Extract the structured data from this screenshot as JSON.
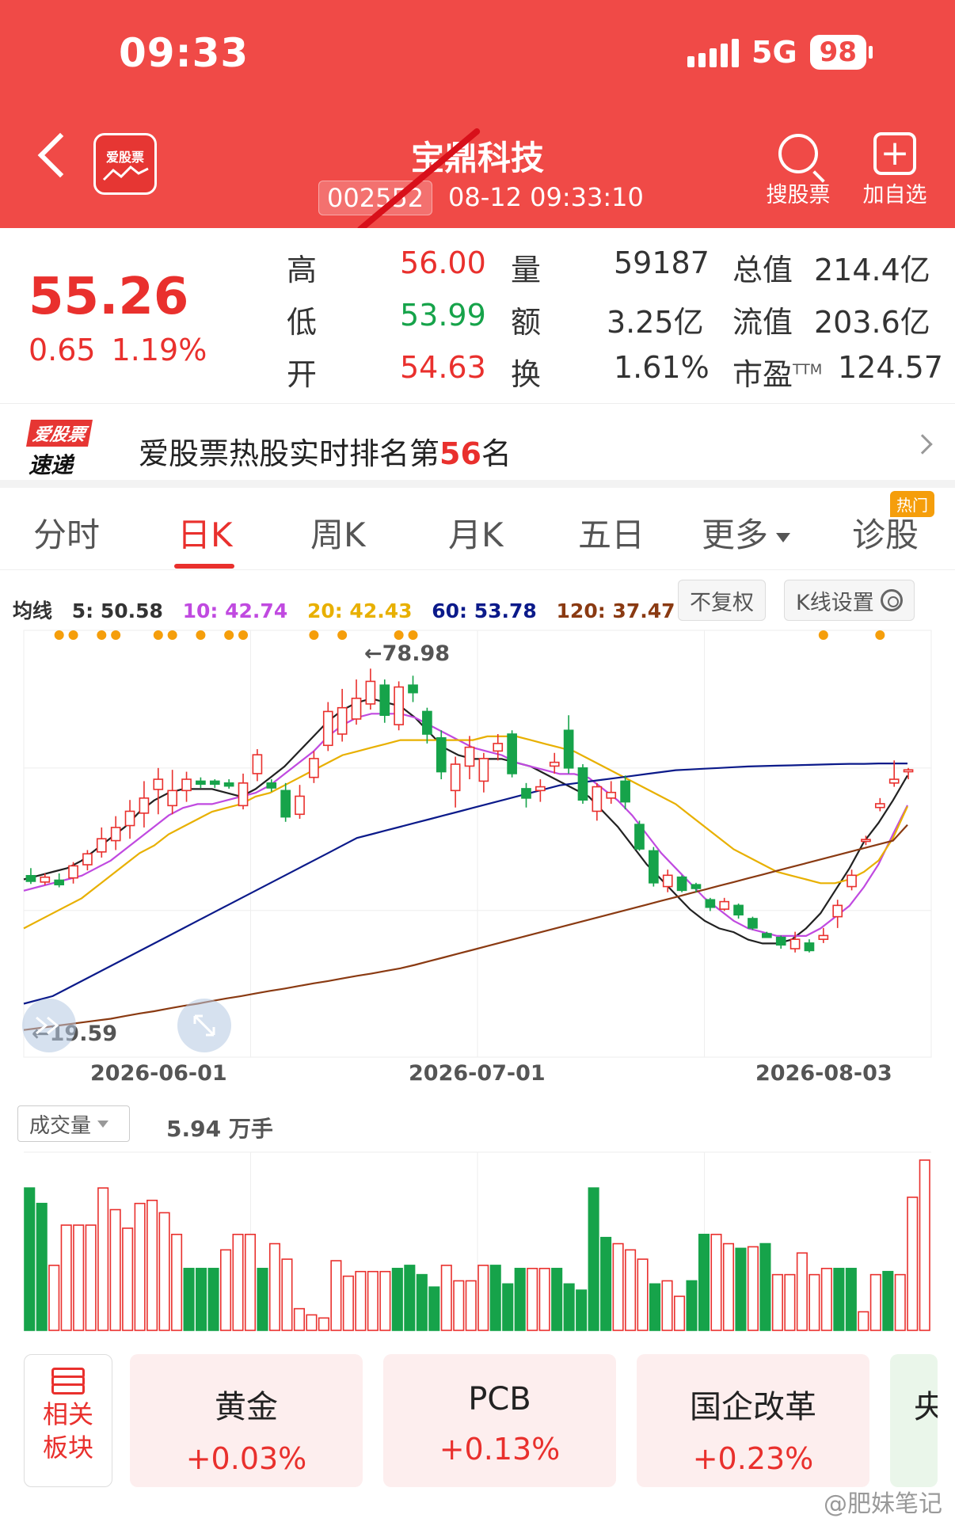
{
  "status": {
    "time": "09:33",
    "network": "5G",
    "battery": "98"
  },
  "header": {
    "logo_text": "爱股票",
    "stock_name": "宝鼎科技",
    "stock_code": "002552",
    "datetime": "08-12 09:33:10",
    "search_label": "搜股票",
    "add_label": "加自选"
  },
  "quote": {
    "price": "55.26",
    "change": "0.65",
    "change_pct": "1.19%",
    "high_label": "高",
    "high": "56.00",
    "low_label": "低",
    "low": "53.99",
    "open_label": "开",
    "open": "54.63",
    "vol_label": "量",
    "vol": "59187",
    "amt_label": "额",
    "amt": "3.25亿",
    "turn_label": "换",
    "turn": "1.61%",
    "mcap_label": "总值",
    "mcap": "214.4亿",
    "float_label": "流值",
    "float": "203.6亿",
    "pe_label": "市盈",
    "pe_sup": "TTM",
    "pe": "124.57"
  },
  "banner": {
    "logo_a": "爱股票",
    "logo_b": "速递",
    "text_pre": "爱股票热股实时排名第",
    "rank": "56",
    "text_post": "名"
  },
  "tabs": {
    "items": [
      "分时",
      "日K",
      "周K",
      "月K",
      "五日",
      "更多",
      "诊股"
    ],
    "active": "日K",
    "hot_badge": "热门"
  },
  "ma": {
    "title": "均线",
    "ma5": "5: 50.58",
    "ma10": "10: 42.74",
    "ma20": "20: 42.43",
    "ma60": "60: 53.78",
    "ma120": "120: 37.47",
    "colors": {
      "ma5": "#222222",
      "ma10": "#c04ae0",
      "ma20": "#e8b000",
      "ma60": "#0b1a8a",
      "ma120": "#8a3a12"
    }
  },
  "chart_controls": {
    "adjust": "不复权",
    "settings": "K线设置"
  },
  "chart_data": {
    "type": "candlestick",
    "high_label": "←78.98",
    "low_label": "←19.59",
    "x_labels": [
      "2026-06-01",
      "2026-07-01",
      "2026-08-03"
    ],
    "up_color": "#e9302d",
    "down_color": "#16a34a",
    "candles": [
      {
        "o": 24.0,
        "c": 22.5,
        "h": 26.0,
        "l": 21.8
      },
      {
        "o": 22.3,
        "c": 23.6,
        "h": 24.6,
        "l": 21.5
      },
      {
        "o": 22.8,
        "c": 21.6,
        "h": 24.6,
        "l": 20.9
      },
      {
        "o": 23.4,
        "c": 26.6,
        "h": 27.6,
        "l": 21.9
      },
      {
        "o": 26.9,
        "c": 29.8,
        "h": 30.8,
        "l": 25.4
      },
      {
        "o": 30.3,
        "c": 33.8,
        "h": 36.8,
        "l": 28.8
      },
      {
        "o": 33.3,
        "c": 36.8,
        "h": 39.8,
        "l": 30.8
      },
      {
        "o": 37.3,
        "c": 41.1,
        "h": 44.1,
        "l": 33.8
      },
      {
        "o": 40.6,
        "c": 44.6,
        "h": 49.1,
        "l": 36.8
      },
      {
        "o": 46.9,
        "c": 49.6,
        "h": 52.6,
        "l": 40.3
      },
      {
        "o": 42.6,
        "c": 46.6,
        "h": 52.1,
        "l": 40.3
      },
      {
        "o": 46.6,
        "c": 49.6,
        "h": 51.6,
        "l": 43.6
      },
      {
        "o": 49.1,
        "c": 48.3,
        "h": 50.1,
        "l": 47.3
      },
      {
        "o": 49.1,
        "c": 48.3,
        "h": 49.6,
        "l": 47.3
      },
      {
        "o": 48.6,
        "c": 47.8,
        "h": 49.6,
        "l": 47.1
      },
      {
        "o": 42.6,
        "c": 48.6,
        "h": 51.1,
        "l": 41.6
      },
      {
        "o": 51.1,
        "c": 56.1,
        "h": 57.6,
        "l": 49.1
      },
      {
        "o": 48.6,
        "c": 47.3,
        "h": 49.6,
        "l": 46.3
      },
      {
        "o": 46.6,
        "c": 39.6,
        "h": 48.6,
        "l": 38.3
      },
      {
        "o": 40.3,
        "c": 45.1,
        "h": 48.1,
        "l": 39.1
      },
      {
        "o": 50.1,
        "c": 55.1,
        "h": 57.1,
        "l": 48.6
      },
      {
        "o": 58.6,
        "c": 67.6,
        "h": 70.1,
        "l": 57.1
      },
      {
        "o": 61.6,
        "c": 68.6,
        "h": 73.6,
        "l": 59.6
      },
      {
        "o": 65.6,
        "c": 71.1,
        "h": 76.1,
        "l": 64.1
      },
      {
        "o": 69.6,
        "c": 75.6,
        "h": 78.98,
        "l": 68.1
      },
      {
        "o": 74.6,
        "c": 66.6,
        "h": 76.1,
        "l": 64.6
      },
      {
        "o": 64.1,
        "c": 74.1,
        "h": 75.6,
        "l": 62.6
      },
      {
        "o": 74.6,
        "c": 72.6,
        "h": 77.1,
        "l": 70.1
      },
      {
        "o": 67.6,
        "c": 61.6,
        "h": 68.6,
        "l": 59.1
      },
      {
        "o": 60.6,
        "c": 51.6,
        "h": 62.6,
        "l": 49.6
      },
      {
        "o": 46.6,
        "c": 53.6,
        "h": 55.6,
        "l": 42.1
      },
      {
        "o": 53.1,
        "c": 58.1,
        "h": 61.1,
        "l": 49.6
      },
      {
        "o": 49.1,
        "c": 55.1,
        "h": 56.6,
        "l": 46.1
      },
      {
        "o": 57.1,
        "c": 59.1,
        "h": 61.6,
        "l": 54.6
      },
      {
        "o": 61.6,
        "c": 51.1,
        "h": 62.6,
        "l": 50.1
      },
      {
        "o": 47.1,
        "c": 44.6,
        "h": 48.6,
        "l": 42.1
      },
      {
        "o": 46.6,
        "c": 47.6,
        "h": 49.6,
        "l": 43.6
      },
      {
        "o": 53.1,
        "c": 54.1,
        "h": 56.6,
        "l": 51.1
      },
      {
        "o": 62.6,
        "c": 52.6,
        "h": 66.6,
        "l": 51.1
      },
      {
        "o": 52.6,
        "c": 44.1,
        "h": 53.6,
        "l": 43.1
      },
      {
        "o": 41.1,
        "c": 47.6,
        "h": 48.6,
        "l": 38.6
      },
      {
        "o": 44.6,
        "c": 46.1,
        "h": 49.1,
        "l": 43.1
      },
      {
        "o": 49.1,
        "c": 43.6,
        "h": 50.6,
        "l": 41.6
      },
      {
        "o": 37.6,
        "c": 31.1,
        "h": 38.6,
        "l": 30.6
      },
      {
        "o": 30.6,
        "c": 22.1,
        "h": 31.6,
        "l": 21.1
      },
      {
        "o": 21.1,
        "c": 24.1,
        "h": 25.6,
        "l": 19.6
      },
      {
        "o": 23.6,
        "c": 20.1,
        "h": 24.1,
        "l": 19.59
      },
      {
        "o": 21.6,
        "c": 20.6,
        "h": 22.1,
        "l": 19.6
      },
      {
        "o": 17.6,
        "c": 15.6,
        "h": 18.1,
        "l": 14.6
      },
      {
        "o": 15.1,
        "c": 17.1,
        "h": 18.1,
        "l": 14.6
      },
      {
        "o": 16.1,
        "c": 13.6,
        "h": 16.6,
        "l": 12.6
      },
      {
        "o": 12.6,
        "c": 10.1,
        "h": 13.1,
        "l": 9.6
      },
      {
        "o": 8.6,
        "c": 7.6,
        "h": 9.1,
        "l": 7.6
      },
      {
        "o": 7.6,
        "c": 5.6,
        "h": 8.1,
        "l": 4.6
      },
      {
        "o": 4.6,
        "c": 7.1,
        "h": 9.1,
        "l": 3.6
      },
      {
        "o": 6.1,
        "c": 4.1,
        "h": 7.1,
        "l": 3.6
      },
      {
        "o": 7.1,
        "c": 8.1,
        "h": 10.1,
        "l": 6.1
      },
      {
        "o": 13.1,
        "c": 16.1,
        "h": 17.6,
        "l": 10.1
      },
      {
        "o": 21.1,
        "c": 24.1,
        "h": 25.6,
        "l": 20.1
      },
      {
        "o": 33.1,
        "c": 33.6,
        "h": 34.6,
        "l": 32.1
      },
      {
        "o": 42.1,
        "c": 43.1,
        "h": 44.6,
        "l": 41.1
      },
      {
        "o": 48.6,
        "c": 49.6,
        "h": 54.6,
        "l": 47.6
      },
      {
        "o": 51.6,
        "c": 52.1,
        "h": 52.6,
        "l": 49.6
      }
    ],
    "ma_lines": {
      "ma5": [
        23,
        24,
        25,
        26,
        28,
        31,
        34,
        37,
        41,
        44,
        46,
        47,
        47,
        47,
        46,
        45,
        47,
        50,
        53,
        57,
        61,
        65,
        68,
        70,
        71,
        70,
        69,
        66,
        62,
        58,
        56,
        55,
        55,
        55,
        54,
        53,
        51,
        49,
        47,
        45,
        41,
        37,
        32,
        27,
        23,
        19,
        15,
        12,
        10,
        9,
        7,
        6,
        6,
        7,
        10,
        14,
        20,
        26,
        33,
        38,
        44,
        50.6
      ],
      "ma10": [
        20,
        21,
        22,
        23,
        24,
        26,
        28,
        31,
        34,
        37,
        40,
        42,
        43,
        43,
        44,
        45,
        46,
        48,
        51,
        54,
        57,
        61,
        64,
        66,
        67,
        67,
        67,
        66,
        64,
        62,
        60,
        58,
        57,
        56,
        54,
        53,
        52,
        51,
        51,
        50,
        47,
        44,
        40,
        35,
        30,
        26,
        22,
        18,
        15,
        12,
        10,
        9,
        8,
        8,
        8,
        10,
        13,
        16,
        21,
        27,
        35,
        42.7
      ],
      "ma20": [
        10,
        12,
        14,
        16,
        18,
        21,
        24,
        27,
        30,
        32,
        35,
        37,
        39,
        41,
        42,
        43,
        45,
        46,
        48,
        50,
        52,
        54,
        56,
        57,
        58,
        59,
        60,
        60,
        60,
        60,
        60,
        60,
        61,
        61,
        61,
        60,
        59,
        58,
        57,
        55,
        53,
        51,
        49,
        47,
        45,
        43,
        40,
        37,
        34,
        31,
        29,
        27,
        25,
        24,
        23,
        22,
        22,
        23,
        25,
        28,
        34,
        42.4
      ],
      "ma60": [
        -10,
        -9,
        -8,
        -6,
        -4,
        -2,
        0,
        2,
        4,
        6,
        8,
        10,
        12,
        14,
        16,
        18,
        20,
        22,
        24,
        26,
        28,
        30,
        32,
        34,
        35,
        36,
        37,
        38,
        39,
        40,
        41,
        42,
        43,
        44,
        45,
        46,
        47,
        48,
        48.5,
        49,
        49.5,
        50,
        50.5,
        51,
        51.5,
        52,
        52.2,
        52.4,
        52.6,
        52.8,
        53,
        53.1,
        53.2,
        53.3,
        53.4,
        53.5,
        53.6,
        53.7,
        53.7,
        53.8,
        53.8,
        53.8
      ],
      "ma120": [
        -17,
        -16.5,
        -16,
        -15.5,
        -15,
        -14.5,
        -14,
        -13.3,
        -12.6,
        -12,
        -11.3,
        -10.6,
        -10,
        -9.3,
        -8.6,
        -8,
        -7.3,
        -6.6,
        -6,
        -5.3,
        -4.6,
        -4,
        -3.3,
        -2.6,
        -2,
        -1.3,
        -0.6,
        0.3,
        1.3,
        2.3,
        3.3,
        4.3,
        5.3,
        6.3,
        7.3,
        8.3,
        9.3,
        10.3,
        11.3,
        12.3,
        13.3,
        14.3,
        15.3,
        16.3,
        17.3,
        18.3,
        19.3,
        20.3,
        21.3,
        22.3,
        23.3,
        24.3,
        25.3,
        26.3,
        27.3,
        28.3,
        29.3,
        30.3,
        31.3,
        32.3,
        33.3,
        37.5
      ]
    },
    "volume": [
      92,
      82,
      42,
      68,
      68,
      68,
      92,
      78,
      66,
      82,
      84,
      76,
      62,
      40,
      40,
      40,
      52,
      62,
      62,
      40,
      56,
      46,
      14,
      10,
      8,
      45,
      35,
      38,
      38,
      38,
      40,
      42,
      36,
      28,
      42,
      32,
      32,
      42,
      42,
      30,
      40,
      40,
      40,
      40,
      30,
      26,
      92,
      60,
      56,
      52,
      46,
      30,
      32,
      22,
      32,
      62,
      62,
      56,
      53,
      54,
      56,
      36,
      36,
      50,
      36,
      40,
      40,
      40,
      12,
      36,
      38,
      36,
      86,
      110
    ],
    "volume_up_flags": [
      0,
      0,
      1,
      1,
      1,
      1,
      1,
      1,
      1,
      1,
      1,
      1,
      1,
      0,
      0,
      0,
      1,
      1,
      1,
      0,
      1,
      1,
      1,
      1,
      1,
      1,
      1,
      1,
      1,
      1,
      0,
      0,
      0,
      0,
      1,
      1,
      1,
      1,
      0,
      0,
      0,
      1,
      1,
      0,
      0,
      0,
      0,
      0,
      1,
      1,
      1,
      0,
      1,
      1,
      0,
      0,
      1,
      1,
      0,
      1,
      0,
      1,
      1,
      1,
      1,
      1,
      0,
      0,
      1,
      1,
      0,
      1,
      1,
      1
    ],
    "volume_label": "5.94 万手"
  },
  "volume_panel": {
    "selector": "成交量"
  },
  "sectors": {
    "title": "相关板块",
    "items": [
      {
        "name": "黄金",
        "pct": "+0.03%"
      },
      {
        "name": "PCB",
        "pct": "+0.13%"
      },
      {
        "name": "国企改革",
        "pct": "+0.23%"
      },
      {
        "name": "央",
        "pct": ""
      }
    ]
  },
  "watermark": "@肥妹笔记"
}
